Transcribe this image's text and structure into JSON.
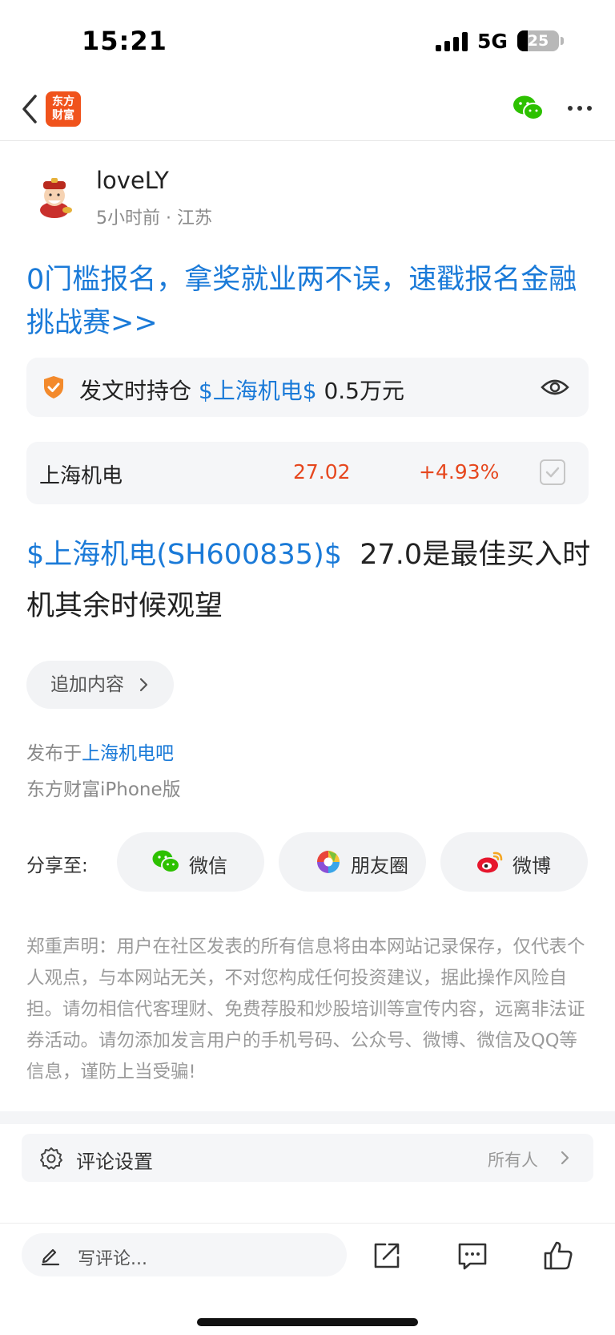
{
  "status_bar": {
    "time": "15:21",
    "network": "5G",
    "battery": "25"
  },
  "nav": {
    "logo_line1": "东方",
    "logo_line2": "财富"
  },
  "author": {
    "name": "loveLY",
    "meta": "5小时前 · 江苏"
  },
  "promo_text": "0门槛报名，拿奖就业两不误，速戳报名金融挑战赛>>",
  "holding": {
    "prefix": "发文时持仓",
    "stock_link": "$上海机电$",
    "amount": "0.5万元"
  },
  "quote": {
    "name": "上海机电",
    "price": "27.02",
    "change": "+4.93%"
  },
  "post": {
    "stock_link": "$上海机电(SH600835)$",
    "text": "27.0是最佳买入时机其余时候观望"
  },
  "append_label": "追加内容",
  "published": {
    "prefix": "发布于",
    "bar_link": "上海机电吧",
    "client": "东方财富iPhone版"
  },
  "share": {
    "label": "分享至:",
    "wechat": "微信",
    "moments": "朋友圈",
    "weibo": "微博"
  },
  "disclaimer": "郑重声明：用户在社区发表的所有信息将由本网站记录保存，仅代表个人观点，与本网站无关，不对您构成任何投资建议，据此操作风险自担。请勿相信代客理财、免费荐股和炒股培训等宣传内容，远离非法证券活动。请勿添加发言用户的手机号码、公众号、微博、微信及QQ等信息，谨防上当受骗!",
  "comment_settings": {
    "label": "评论设置",
    "value": "所有人"
  },
  "bottom_bar": {
    "placeholder": "写评论..."
  },
  "colors": {
    "link": "#1a7ad8",
    "up": "#e6471e",
    "brand": "#f0531c",
    "wechat": "#2dc100"
  }
}
